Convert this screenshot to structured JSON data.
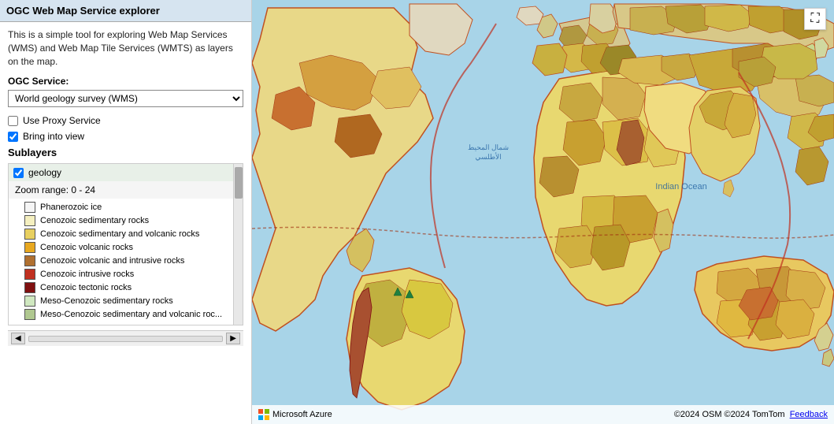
{
  "sidebar": {
    "header": "OGC Web Map Service explorer",
    "description": "This is a simple tool for exploring Web Map Services (WMS) and Web Map Tile Services (WMTS) as layers on the map.",
    "ogc_service_label": "OGC Service:",
    "ogc_dropdown_value": "World geology survey (WMS)",
    "ogc_dropdown_options": [
      "World geology survey (WMS)"
    ],
    "use_proxy_label": "Use Proxy Service",
    "use_proxy_checked": false,
    "bring_into_view_label": "Bring into view",
    "bring_into_view_checked": true,
    "sublayers_label": "Sublayers",
    "sublayer_name": "geology",
    "sublayer_checked": true,
    "zoom_range_label": "Zoom range: 0 - 24",
    "legend_items": [
      {
        "color": "#f5f5f5",
        "label": "Phanerozoic ice"
      },
      {
        "color": "#f5f0c0",
        "label": "Cenozoic sedimentary rocks"
      },
      {
        "color": "#e8d060",
        "label": "Cenozoic sedimentary and volcanic rocks"
      },
      {
        "color": "#e8a820",
        "label": "Cenozoic volcanic rocks"
      },
      {
        "color": "#b07030",
        "label": "Cenozoic volcanic and intrusive rocks"
      },
      {
        "color": "#c03020",
        "label": "Cenozoic intrusive rocks"
      },
      {
        "color": "#801010",
        "label": "Cenozoic tectonic rocks"
      },
      {
        "color": "#d0e8c0",
        "label": "Meso-Cenozoic sedimentary rocks"
      },
      {
        "color": "#b0c890",
        "label": "Meso-Cenozoic sedimentary and volcanic roc..."
      }
    ]
  },
  "map": {
    "zoom_button_label": "□",
    "footer_provider": "Microsoft Azure",
    "footer_copyright": "©2024 OSM ©2024 TomTom",
    "feedback_label": "Feedback",
    "ocean_label_1": "شمال المحيط",
    "ocean_label_2": "الأطلسي",
    "ocean_label_3": "Indian Ocean"
  }
}
